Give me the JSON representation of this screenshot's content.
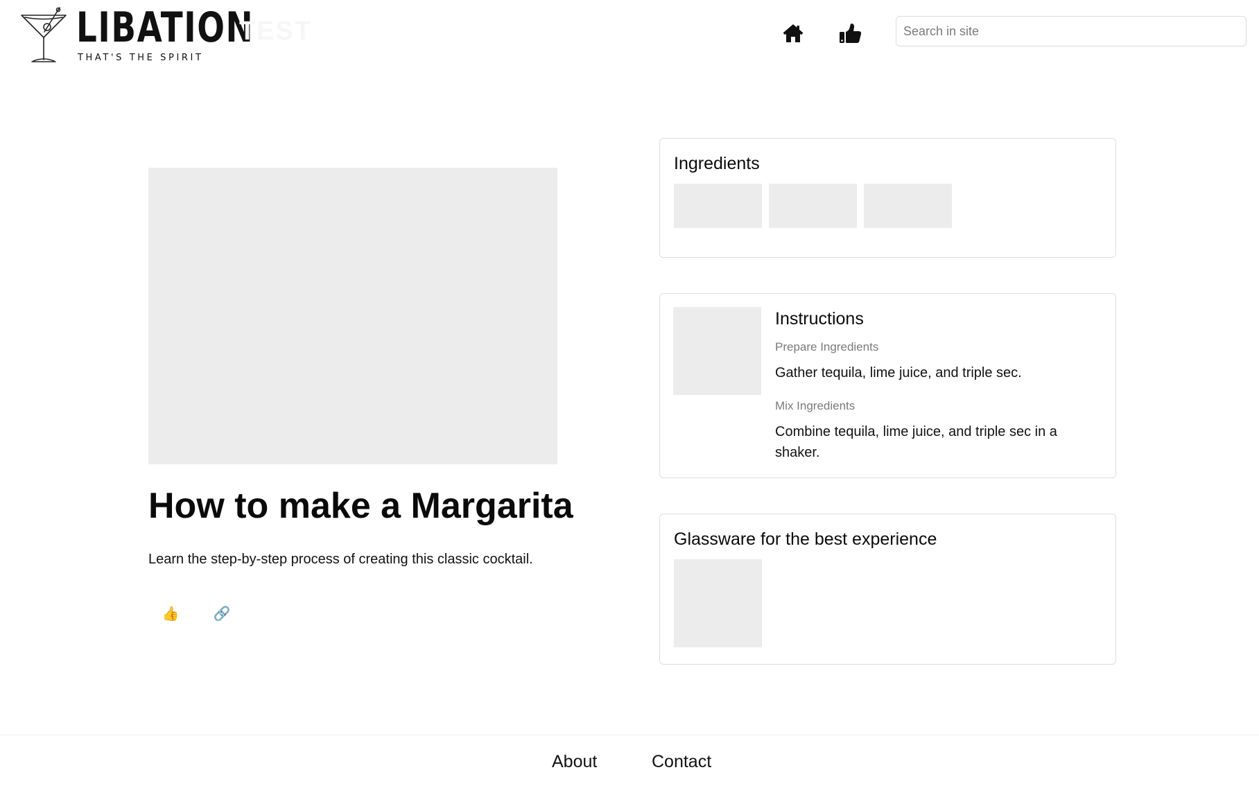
{
  "header": {
    "logo_wordmark": "LIBATION",
    "logo_tagline": "THAT'S THE SPIRIT",
    "env_label": "TEST",
    "nav": {
      "home_icon": "home-icon",
      "likes_icon": "thumbs-up-icon"
    },
    "search": {
      "placeholder": "Search in site",
      "value": ""
    }
  },
  "recipe": {
    "title": "How to make a Margarita",
    "description": "Learn the step-by-step process of creating this classic cocktail.",
    "actions": {
      "like_glyph": "👍",
      "link_glyph": "🔗"
    }
  },
  "ingredients": {
    "heading": "Ingredients"
  },
  "instructions": {
    "heading": "Instructions",
    "steps": [
      {
        "label": "Prepare Ingredients",
        "text": "Gather tequila, lime juice, and triple sec."
      },
      {
        "label": "Mix Ingredients",
        "text": "Combine tequila, lime juice, and triple sec in a shaker."
      }
    ]
  },
  "glassware": {
    "heading": "Glassware for the best experience"
  },
  "footer": {
    "links": [
      {
        "label": "About"
      },
      {
        "label": "Contact"
      }
    ]
  },
  "colors": {
    "placeholder_gray": "#ececec",
    "border": "#dedede",
    "muted_text": "#7a7a7a",
    "text": "#111111"
  }
}
